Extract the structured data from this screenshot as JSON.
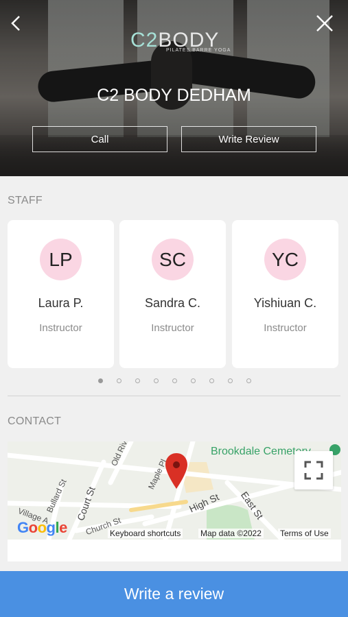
{
  "hero": {
    "title": "C2 BODY DEDHAM",
    "logo_c2": "C2",
    "logo_body": "BODY",
    "logo_sub": "PILATES BARRE YOGA",
    "call_label": "Call",
    "write_review_label": "Write Review"
  },
  "staff": {
    "label": "STAFF",
    "members": [
      {
        "initials": "LP",
        "name": "Laura P.",
        "role": "Instructor"
      },
      {
        "initials": "SC",
        "name": "Sandra C.",
        "role": "Instructor"
      },
      {
        "initials": "YC",
        "name": "Yishiuan C.",
        "role": "Instructor"
      }
    ],
    "page_count": 9,
    "active_page": 1
  },
  "contact": {
    "label": "CONTACT",
    "map": {
      "place_label": "Brookdale Cemetery",
      "streets": [
        "Old River",
        "Maple Pl",
        "High St",
        "East St",
        "Court St",
        "Bullard St",
        "Church St",
        "Village A"
      ],
      "keyboard_shortcuts": "Keyboard shortcuts",
      "map_data": "Map data ©2022",
      "terms": "Terms of Use",
      "google": "Google"
    }
  },
  "footer": {
    "cta_label": "Write a review"
  },
  "colors": {
    "primary": "#4a90e2",
    "avatar_bg": "#fad6e3",
    "pin": "#d93025",
    "park": "#37a267"
  }
}
